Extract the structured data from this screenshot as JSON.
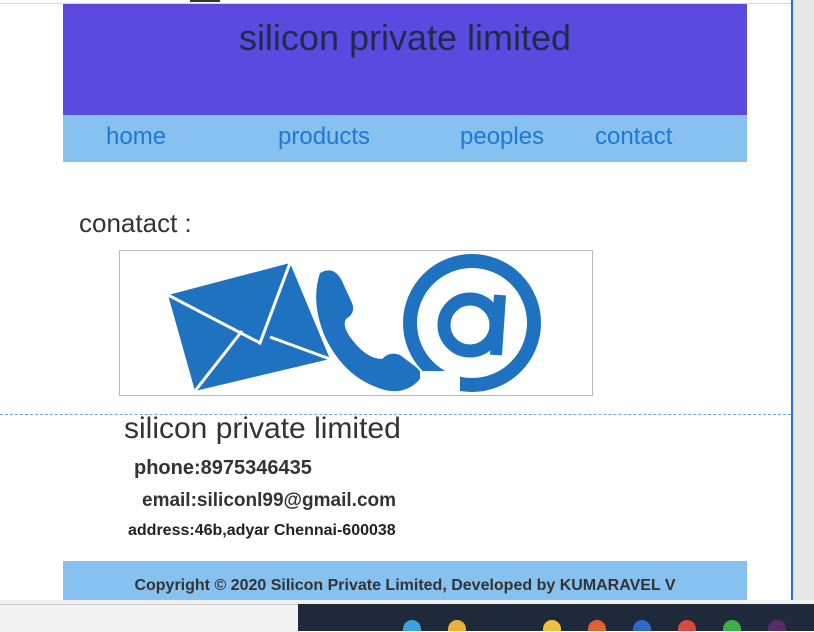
{
  "site": {
    "title": "silicon private limited"
  },
  "nav": {
    "items": [
      {
        "label": "home"
      },
      {
        "label": "products"
      },
      {
        "label": "peoples"
      },
      {
        "label": "contact"
      }
    ]
  },
  "contact": {
    "heading": "conatact :",
    "image_icons": [
      "envelope-icon",
      "telephone-handset-icon",
      "at-sign-icon"
    ]
  },
  "details": {
    "company": "silicon private limited",
    "phone": "phone:8975346435",
    "email": "email:siliconl99@gmail.com",
    "address": "address:46b,adyar Chennai-600038"
  },
  "footer": {
    "copyright": "Copyright © 2020 Silicon Private Limited, Developed by KUMARAVEL V"
  },
  "colors": {
    "header_bg": "#5b4ae0",
    "nav_bg": "#87c1f0",
    "nav_link": "#1e78d6",
    "icon_blue": "#1f72c0"
  }
}
